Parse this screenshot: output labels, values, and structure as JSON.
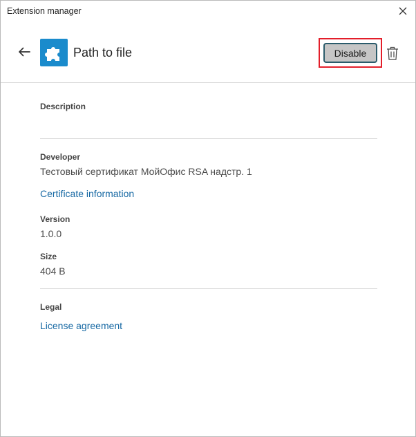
{
  "window": {
    "title": "Extension manager"
  },
  "header": {
    "extension_name": "Path to file",
    "disable_label": "Disable"
  },
  "details": {
    "description_label": "Description",
    "description_value": "",
    "developer_label": "Developer",
    "developer_value": "Тестовый сертификат МойОфис RSA надстр. 1",
    "certificate_link": "Certificate information",
    "version_label": "Version",
    "version_value": "1.0.0",
    "size_label": "Size",
    "size_value": "404 B",
    "legal_label": "Legal",
    "license_link": "License agreement"
  },
  "icons": {
    "close": "close-icon",
    "back": "arrow-left-icon",
    "extension": "puzzle-piece-icon",
    "delete": "trash-icon"
  },
  "colors": {
    "accent": "#1a8bcc",
    "link": "#1668a3",
    "highlight": "#e31e2a",
    "button_bg": "#c6c6c6",
    "button_border": "#2b5b6b"
  }
}
